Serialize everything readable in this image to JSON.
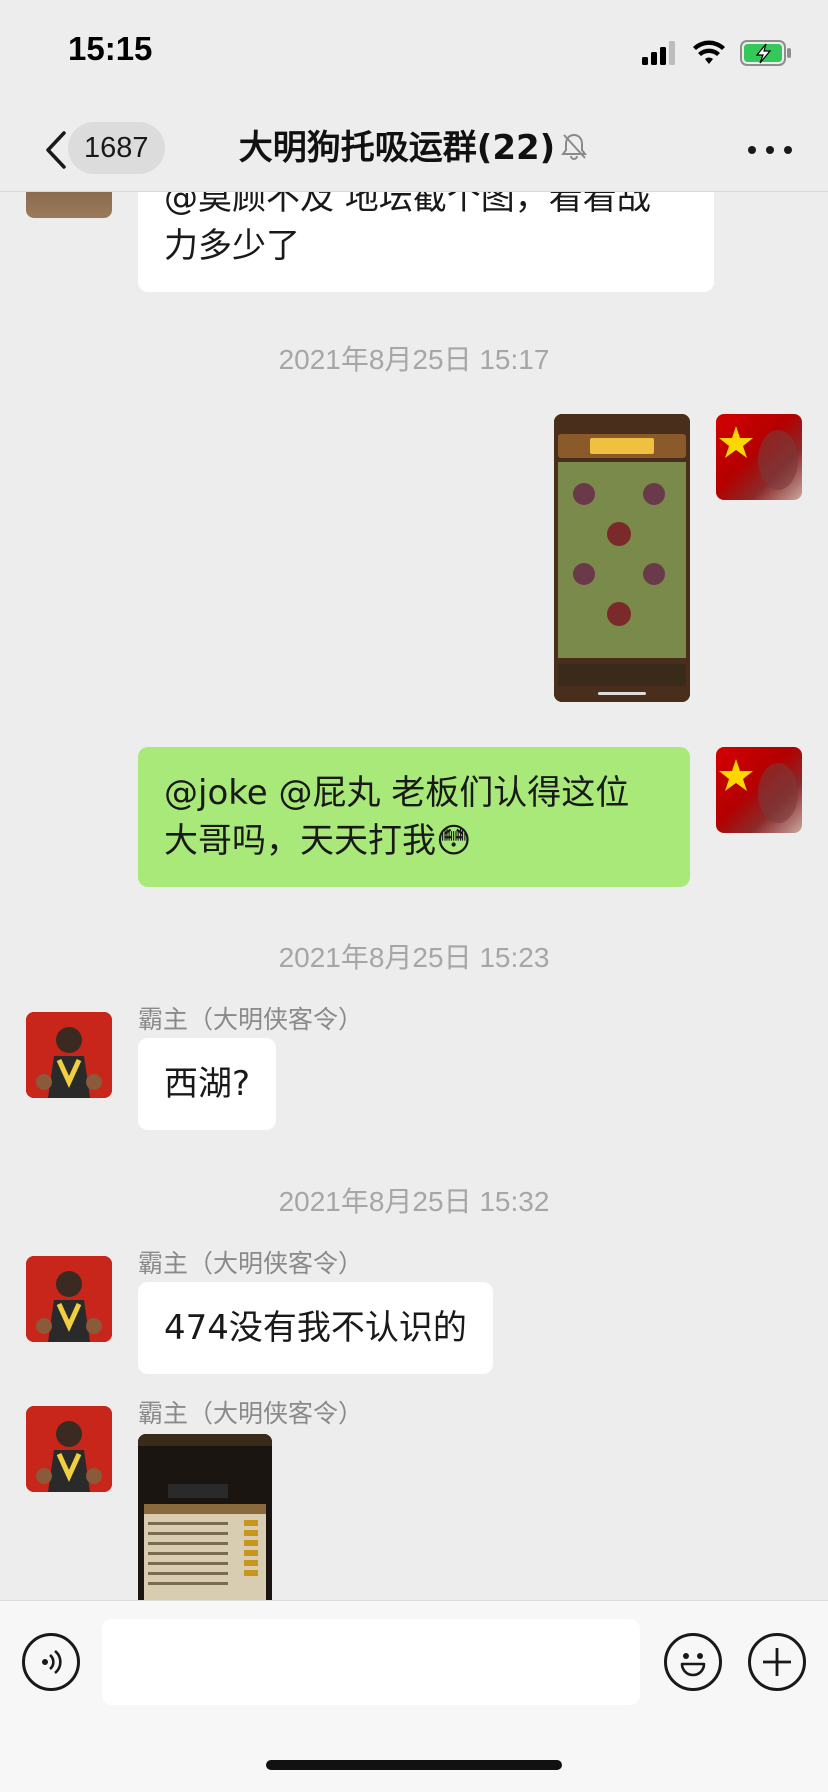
{
  "status_bar": {
    "time": "15:15",
    "icons": [
      "signal-icon",
      "wifi-icon",
      "battery-charging-icon"
    ],
    "battery_color": "#34c759"
  },
  "nav": {
    "unread_count": "1687",
    "title": "大明狗托吸运群(22)",
    "icons": [
      "back-chevron-icon",
      "mute-bell-icon",
      "more-icon"
    ]
  },
  "messages": {
    "m0": {
      "text_line1": "@莫顾不及 地坛截个图，看看战",
      "text_line2": "力多少了"
    },
    "t1": "2021年8月25日 15:17",
    "m2": {
      "text_line1": "@joke  @屁丸 老板们认得这位",
      "text_line2": "大哥吗，天天打我😳"
    },
    "t2": "2021年8月25日 15:23",
    "m3": {
      "sender": "霸主（大明侠客令）",
      "text": "西湖?"
    },
    "t3": "2021年8月25日 15:32",
    "m4": {
      "sender": "霸主（大明侠客令）",
      "text": "474没有我不认识的"
    },
    "m5": {
      "sender": "霸主（大明侠客令）"
    }
  },
  "colors": {
    "background": "#ededed",
    "green_bubble": "#a9e97a",
    "white_bubble": "#ffffff",
    "timestamp": "#a6a6a6"
  },
  "input_bar": {
    "icons": [
      "voice-icon",
      "emoji-icon",
      "plus-icon"
    ],
    "value": ""
  }
}
